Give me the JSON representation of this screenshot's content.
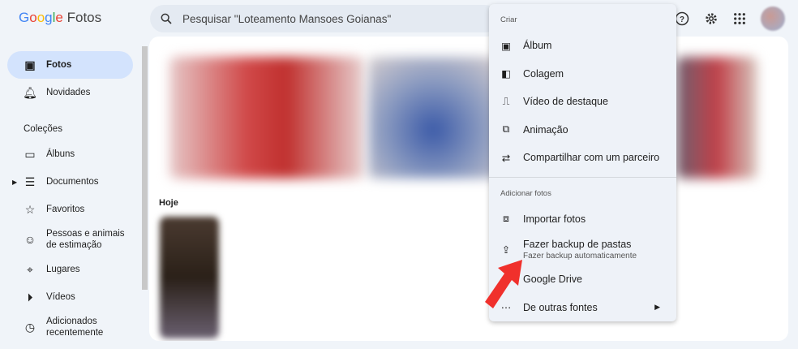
{
  "app": {
    "logo": "Google Fotos",
    "logo_letters": [
      "G",
      "o",
      "o",
      "g",
      "l",
      "e"
    ],
    "logo_suffix": "Fotos"
  },
  "search": {
    "placeholder": "Pesquisar \"Loteamento Mansoes Goianas\""
  },
  "header_icons": [
    "help-icon",
    "settings-icon",
    "apps-icon",
    "avatar"
  ],
  "sidebar": {
    "items": [
      {
        "label": "Fotos",
        "icon": "photo-icon",
        "active": true
      },
      {
        "label": "Novidades",
        "icon": "bell-icon"
      }
    ],
    "collections_title": "Coleções",
    "collections": [
      {
        "label": "Álbuns",
        "icon": "album-icon"
      },
      {
        "label": "Documentos",
        "icon": "document-icon"
      },
      {
        "label": "Favoritos",
        "icon": "star-icon"
      },
      {
        "label": "Pessoas e animais de estimação",
        "line1": "Pessoas e animais",
        "line2": "de estimação",
        "icon": "face-icon"
      },
      {
        "label": "Lugares",
        "icon": "location-icon"
      },
      {
        "label": "Vídeos",
        "icon": "play-icon"
      },
      {
        "label": "Adicionados recentemente",
        "line1": "Adicionados",
        "line2": "recentemente",
        "icon": "clock-icon"
      }
    ]
  },
  "main": {
    "date_label": "Hoje"
  },
  "menu": {
    "create_title": "Criar",
    "create": [
      {
        "label": "Álbum"
      },
      {
        "label": "Colagem"
      },
      {
        "label": "Vídeo de destaque"
      },
      {
        "label": "Animação"
      },
      {
        "label": "Compartilhar com um parceiro"
      }
    ],
    "add_title": "Adicionar fotos",
    "add": [
      {
        "label": "Importar fotos"
      },
      {
        "label": "Fazer backup de pastas",
        "sub": "Fazer backup automaticamente"
      },
      {
        "label": "Google Drive"
      },
      {
        "label": "De outras fontes"
      }
    ]
  },
  "colors": {
    "active": "#d3e3fd",
    "arrow": "#f0302c",
    "bg": "#f0f4f9"
  }
}
